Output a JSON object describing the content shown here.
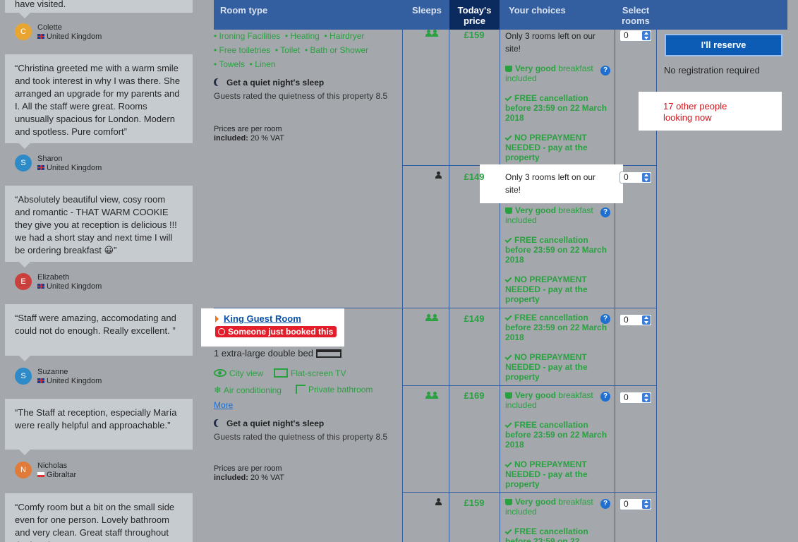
{
  "reviews": [
    {
      "text": "have visited.",
      "name": "Colette",
      "initial": "C",
      "avatar_color": "#e8a630",
      "country": "United Kingdom",
      "flag": "uk"
    },
    {
      "text": "“Christina greeted me with a warm smile and took interest in why I was there. She arranged an upgrade for my parents and I. All the staff were great. Rooms unusually spacious for London. Modern and spotless. Pure comfort”",
      "name": "Sharon",
      "initial": "S",
      "avatar_color": "#2e8bc8",
      "country": "United Kingdom",
      "flag": "uk"
    },
    {
      "text": "“Absolutely beautiful view, cosy room and romantic - THAT WARM COOKIE they give you at reception is delicious !!! we had a short stay and next time I will be ordering breakfast 😀”",
      "name": "Elizabeth",
      "initial": "E",
      "avatar_color": "#c9403c",
      "country": "United Kingdom",
      "flag": "uk"
    },
    {
      "text": "“Staff were amazing, accomodating and could not do enough. Really excellent. ”",
      "name": "Suzanne",
      "initial": "S",
      "avatar_color": "#2e8bc8",
      "country": "United Kingdom",
      "flag": "uk"
    },
    {
      "text": "“The Staff at reception, especially María were really helpful and approachable.”",
      "name": "Nicholas",
      "initial": "N",
      "avatar_color": "#e07b3a",
      "country": "Gibraltar",
      "flag": "gi"
    },
    {
      "text": "“Comfy room but a bit on the small side even for one person. Lovely bathroom and very clean. Great staff throughout the hotel!”"
    }
  ],
  "table": {
    "headers": {
      "room_type": "Room type",
      "sleeps": "Sleeps",
      "price_line1": "Today's",
      "price_line2": "price",
      "choices": "Your choices",
      "select_line1": "Select",
      "select_line2": "rooms"
    },
    "room1": {
      "features": [
        [
          "Ironing Facilities",
          "Heating",
          "Hairdryer"
        ],
        [
          "Free toiletries",
          "Toilet",
          "Bath or Shower"
        ],
        [
          "Towels",
          "Linen"
        ]
      ],
      "quiet_title": "Get a quiet night's sleep",
      "quiet_text": "Guests rated the quietness of this property 8.5",
      "prices_note": "Prices are per room",
      "vat_label": "included:",
      "vat_value": "20 % VAT"
    },
    "room2": {
      "name": "King Guest Room",
      "badge": "Someone just booked this",
      "bed": "1 extra-large double bed",
      "facilities": [
        "City view",
        "Flat-screen TV",
        "Air conditioning",
        "Private bathroom"
      ],
      "more": "More",
      "quiet_title": "Get a quiet night's sleep",
      "quiet_text": "Guests rated the quietness of this property 8.5",
      "prices_note": "Prices are per room",
      "vat_label": "included:",
      "vat_value": "20 % VAT"
    },
    "options": [
      {
        "price": "£159",
        "scarcity": "Only 3 rooms left on our site!",
        "breakfast_bold": "Very good",
        "breakfast_rest": "breakfast included",
        "cancel": "FREE cancellation before 23:59 on 22 March 2018",
        "prepay": "NO PREPAYMENT NEEDED - pay at the property",
        "qty": "0"
      },
      {
        "price": "£149",
        "scarcity": "Only 3 rooms left on our site!",
        "breakfast_bold": "Very good",
        "breakfast_rest": "breakfast included",
        "cancel": "FREE cancellation before 23:59 on 22 March 2018",
        "prepay": "NO PREPAYMENT NEEDED - pay at the property",
        "qty": "0"
      },
      {
        "price": "£149",
        "cancel": "FREE cancellation before 23:59 on 22 March 2018",
        "prepay": "NO PREPAYMENT NEEDED - pay at the property",
        "qty": "0"
      },
      {
        "price": "£169",
        "breakfast_bold": "Very good",
        "breakfast_rest": "breakfast included",
        "cancel": "FREE cancellation before 23:59 on 22 March 2018",
        "prepay": "NO PREPAYMENT NEEDED - pay at the property",
        "qty": "0"
      },
      {
        "price": "£159",
        "breakfast_bold": "Very good",
        "breakfast_rest": "breakfast included",
        "cancel": "FREE cancellation before 23:59 on 22",
        "qty": "0"
      }
    ]
  },
  "reserve": {
    "button": "I'll reserve",
    "no_registration": "No registration required",
    "looking": "17 other people looking now"
  },
  "colors": {
    "header_blue": "#335fa0",
    "price_header": "#0b2a5e",
    "green": "#2aa140",
    "red": "#e31e2a",
    "reserve_button": "#0c5bb5"
  },
  "icons": [
    "person-icon",
    "moon-icon",
    "coffee-cup-icon",
    "check-icon",
    "question-icon",
    "alarm-clock-icon",
    "bed-icon",
    "eye-icon",
    "tv-icon",
    "snowflake-icon",
    "shower-icon",
    "dropdown-arrows-icon"
  ]
}
